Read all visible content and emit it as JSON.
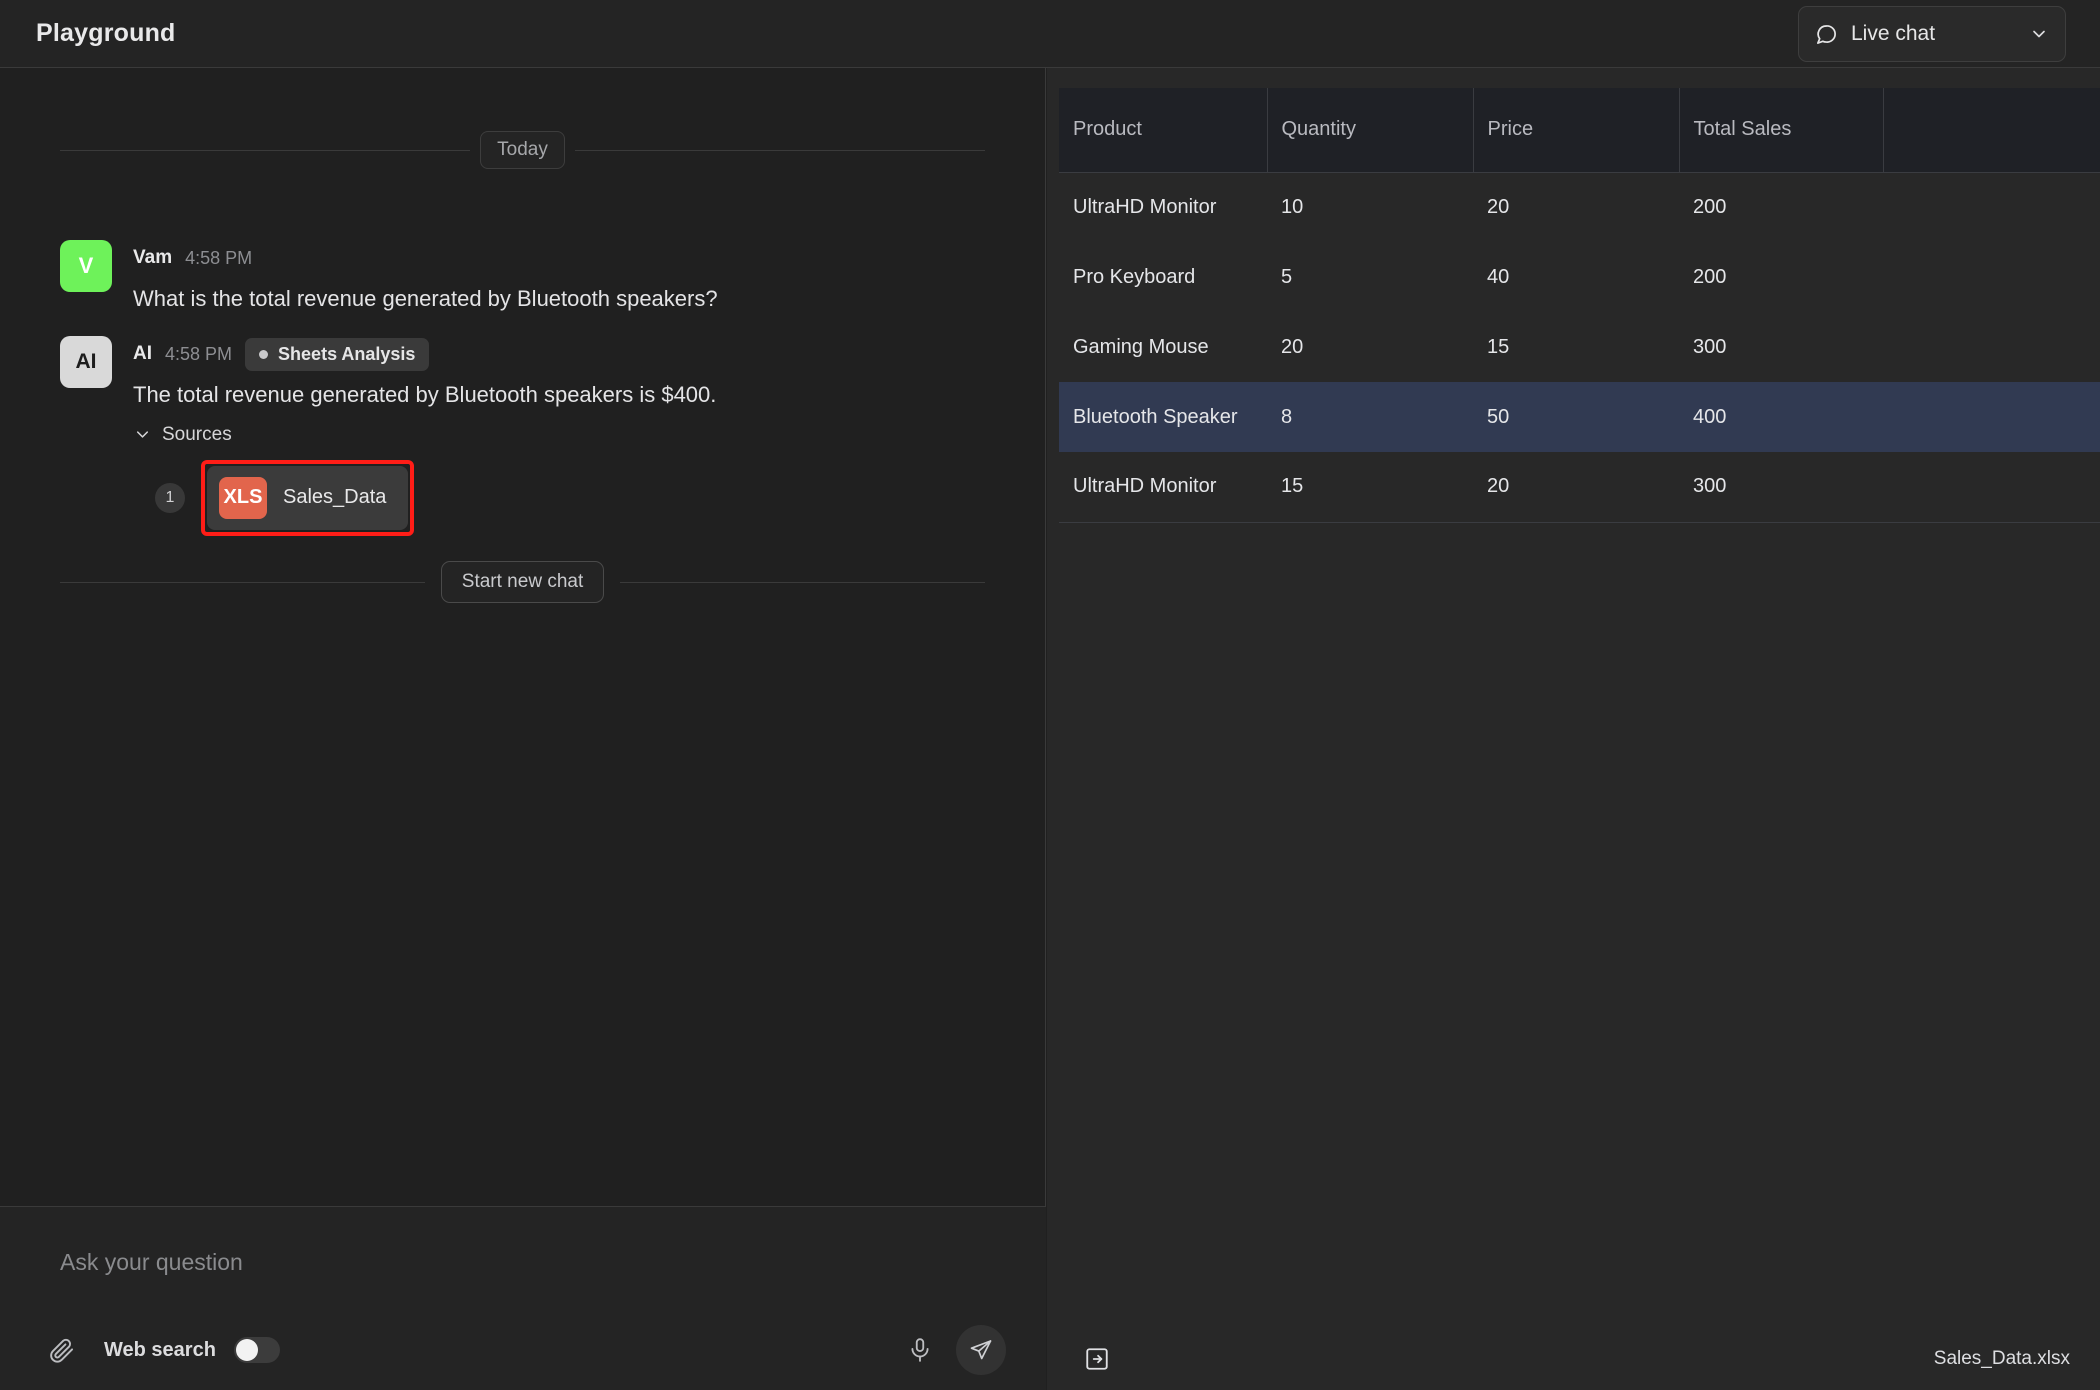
{
  "header": {
    "app_title": "Playground",
    "chat_mode": {
      "label": "Live chat",
      "icon": "chat-bubble-icon",
      "chevron": "chevron-down-icon"
    }
  },
  "conversation": {
    "day_separator": "Today",
    "messages": [
      {
        "author": "Vam",
        "avatar_initial": "V",
        "avatar_color": "#6ef25a",
        "time": "4:58 PM",
        "text": "What is the total revenue generated by Bluetooth speakers?"
      },
      {
        "author": "AI",
        "avatar_initial": "AI",
        "avatar_color": "#d9d9d9",
        "time": "4:58 PM",
        "tag": "Sheets Analysis",
        "text": "The total revenue generated by Bluetooth speakers is $400.",
        "sources_label": "Sources",
        "sources": [
          {
            "index": "1",
            "badge": "XLS",
            "name": "Sales_Data"
          }
        ]
      }
    ],
    "start_new_chat": "Start new chat"
  },
  "composer": {
    "placeholder": "Ask your question",
    "value": "",
    "attach_icon": "paperclip-icon",
    "web_search_label": "Web search",
    "web_search_on": false,
    "mic_icon": "microphone-icon",
    "send_icon": "send-paper-plane-icon"
  },
  "sheet_panel": {
    "footer_filename": "Sales_Data.xlsx",
    "expand_icon": "open-panel-icon",
    "highlight_color": "#313a52"
  },
  "chart_data": {
    "type": "table",
    "title": "Sales_Data.xlsx",
    "columns": [
      "Product",
      "Quantity",
      "Price",
      "Total Sales",
      ""
    ],
    "rows": [
      {
        "cells": [
          "UltraHD Monitor",
          "10",
          "20",
          "200",
          ""
        ],
        "highlighted": false
      },
      {
        "cells": [
          "Pro Keyboard",
          "5",
          "40",
          "200",
          ""
        ],
        "highlighted": false
      },
      {
        "cells": [
          "Gaming Mouse",
          "20",
          "15",
          "300",
          ""
        ],
        "highlighted": false
      },
      {
        "cells": [
          "Bluetooth Speaker",
          "8",
          "50",
          "400",
          ""
        ],
        "highlighted": true
      },
      {
        "cells": [
          "UltraHD Monitor",
          "15",
          "20",
          "300",
          ""
        ],
        "highlighted": false
      }
    ]
  }
}
